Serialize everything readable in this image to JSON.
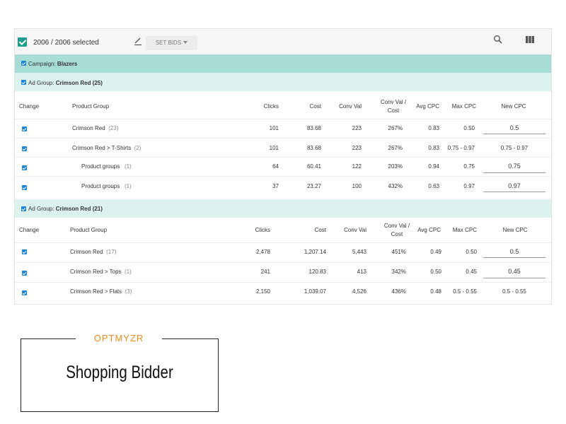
{
  "toolbar": {
    "selected_text": "2006 / 2006 selected",
    "set_bids_label": "SET BIDS"
  },
  "colors": {
    "campaign_band": "#a8ddd6",
    "ad_group_band": "#dcf2ef",
    "checkbox": "#1a84d9",
    "select_all_checkbox": "#1d9e8b",
    "brand": "#f08a1a"
  },
  "campaign": {
    "label": "Campaign: ",
    "name": "Blazers"
  },
  "ad_groups": [
    {
      "label": "Ad Group: ",
      "name": "Crimson Red (25)",
      "columns": {
        "change": "Change",
        "product_group": "Product Group",
        "clicks": "Clicks",
        "cost": "Cost",
        "conv_val": "Conv Val",
        "conv_val_cost_1": "Conv Val /",
        "conv_val_cost_2": "Cost",
        "avg_cpc": "Avg CPC",
        "max_cpc": "Max CPC",
        "new_cpc": "New CPC"
      },
      "rows": [
        {
          "product_group": "Crimson Red",
          "count": "(23)",
          "clicks": "101",
          "cost": "83.68",
          "conv_val": "223",
          "conv_val_cost": "267%",
          "avg_cpc": "0.83",
          "max_cpc": "0.50",
          "new_cpc": "0.5"
        },
        {
          "product_group": "Crimson Red > T-Shirts",
          "count": "(2)",
          "clicks": "101",
          "cost": "83.68",
          "conv_val": "223",
          "conv_val_cost": "267%",
          "avg_cpc": "0.83",
          "max_cpc": "0.75 - 0.97",
          "new_cpc": "0.75 - 0.97"
        },
        {
          "product_group": "Product groups",
          "count": "(1)",
          "clicks": "64",
          "cost": "60.41",
          "conv_val": "122",
          "conv_val_cost": "203%",
          "avg_cpc": "0.94",
          "max_cpc": "0.75",
          "new_cpc": "0.75"
        },
        {
          "product_group": "Product groups",
          "count": "(1)",
          "clicks": "37",
          "cost": "23.27",
          "conv_val": "100",
          "conv_val_cost": "432%",
          "avg_cpc": "0.63",
          "max_cpc": "0.97",
          "new_cpc": "0.97"
        }
      ]
    },
    {
      "label": "Ad Group: ",
      "name": "Crimson Red (21)",
      "columns": {
        "change": "Change",
        "product_group": "Product Group",
        "clicks": "Clicks",
        "cost": "Cost",
        "conv_val": "Conv Val",
        "conv_val_cost_1": "Conv Val /",
        "conv_val_cost_2": "Cost",
        "avg_cpc": "Avg CPC",
        "max_cpc": "Max CPC",
        "new_cpc": "New CPC"
      },
      "rows": [
        {
          "product_group": "Crimson Red",
          "count": "(17)",
          "clicks": "2,478",
          "cost": "1,207.14",
          "conv_val": "5,443",
          "conv_val_cost": "451%",
          "avg_cpc": "0.49",
          "max_cpc": "0.50",
          "new_cpc": "0.5"
        },
        {
          "product_group": "Crimson Red > Tops",
          "count": "(1)",
          "clicks": "241",
          "cost": "120.83",
          "conv_val": "413",
          "conv_val_cost": "342%",
          "avg_cpc": "0.50",
          "max_cpc": "0.45",
          "new_cpc": "0.45"
        },
        {
          "product_group": "Crimson Red > Flats",
          "count": "(3)",
          "clicks": "2,150",
          "cost": "1,039.07",
          "conv_val": "4,526",
          "conv_val_cost": "436%",
          "avg_cpc": "0.48",
          "max_cpc": "0.5 - 0.55",
          "new_cpc": "0.5 - 0.55"
        }
      ]
    }
  ],
  "logo": {
    "brand": "OPTMYZR",
    "product": "Shopping Bidder"
  }
}
